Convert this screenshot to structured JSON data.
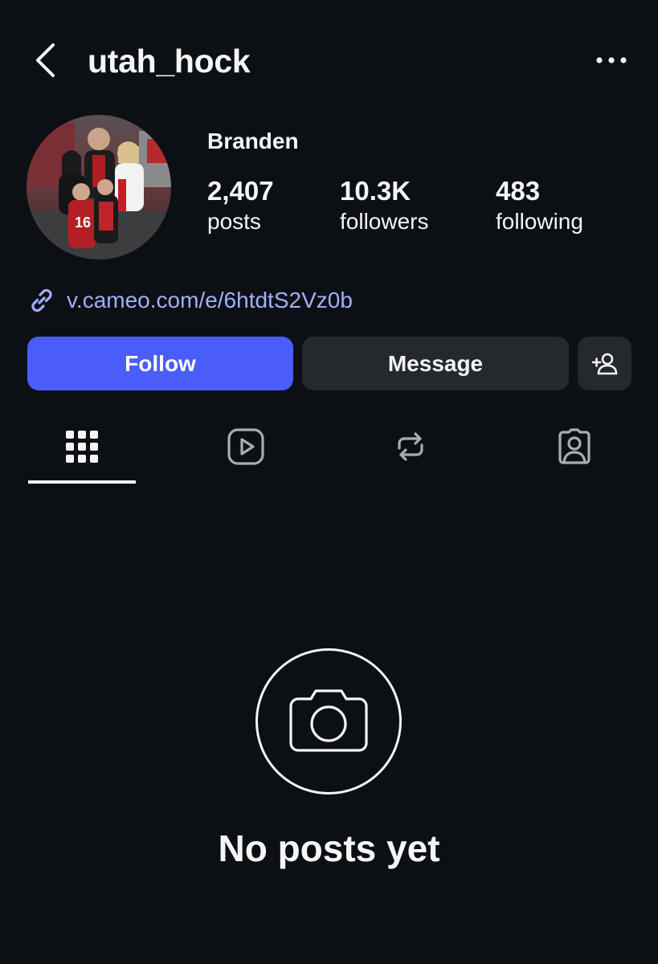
{
  "header": {
    "username": "utah_hock"
  },
  "profile": {
    "display_name": "Branden",
    "stats": [
      {
        "count": "2,407",
        "label": "posts"
      },
      {
        "count": "10.3K",
        "label": "followers"
      },
      {
        "count": "483",
        "label": "following"
      }
    ],
    "link": "v.cameo.com/e/6htdtS2Vz0b"
  },
  "actions": {
    "follow_label": "Follow",
    "message_label": "Message"
  },
  "tabs": [
    {
      "icon": "grid-icon",
      "selected": true
    },
    {
      "icon": "reels-icon",
      "selected": false
    },
    {
      "icon": "reposts-icon",
      "selected": false
    },
    {
      "icon": "tagged-icon",
      "selected": false
    }
  ],
  "empty_state": {
    "icon": "camera-icon",
    "message": "No posts yet"
  },
  "colors": {
    "background": "#0c1014",
    "follow_button": "#4a5dfb",
    "secondary_button": "#25292e",
    "link": "#a3adff"
  }
}
